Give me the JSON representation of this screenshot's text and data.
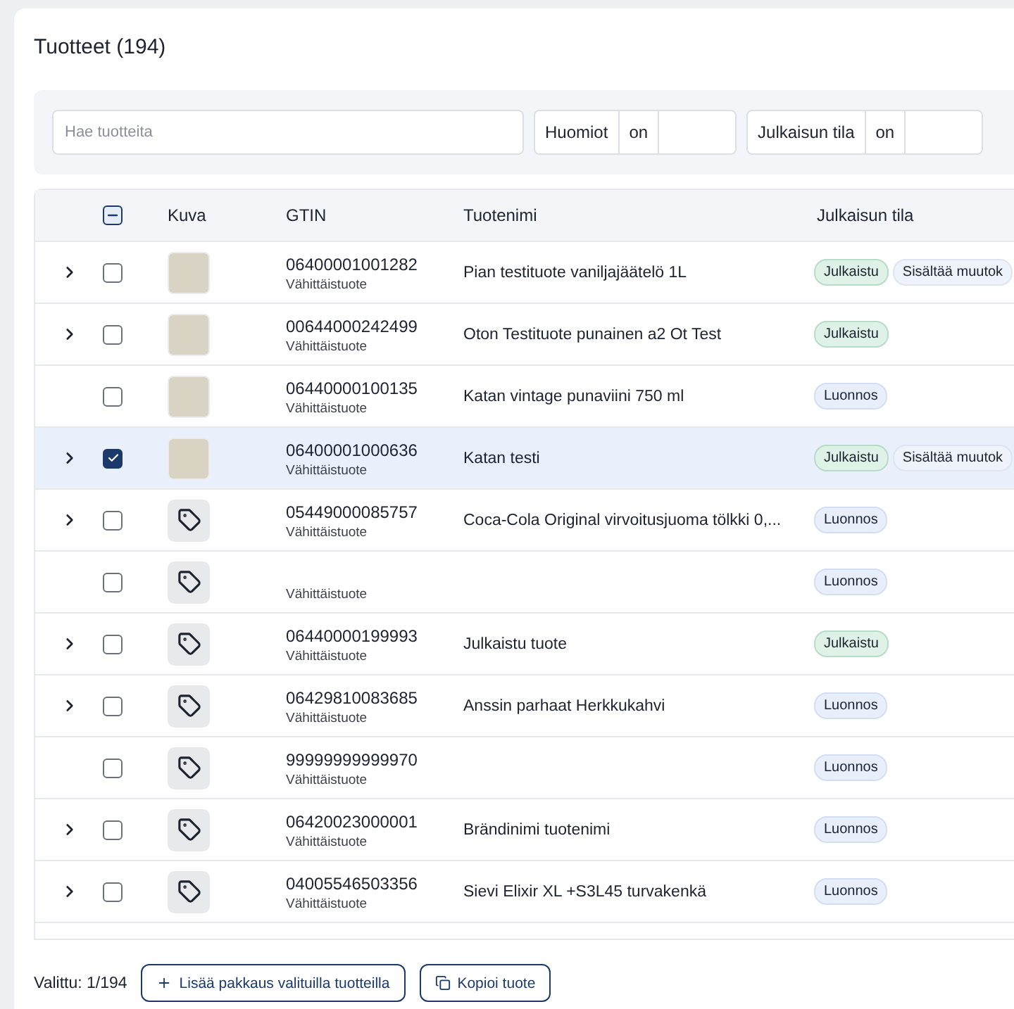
{
  "title": "Tuotteet (194)",
  "search": {
    "placeholder": "Hae tuotteita"
  },
  "filters": [
    {
      "label": "Huomiot",
      "operator": "on"
    },
    {
      "label": "Julkaisun tila",
      "operator": "on"
    }
  ],
  "table": {
    "header_checkbox": {
      "indeterminate": true
    },
    "columns": [
      "Kuva",
      "GTIN",
      "Tuotenimi",
      "Julkaisun tila"
    ],
    "rows": [
      {
        "expandable": true,
        "selected": false,
        "kind": "photo",
        "gtin": "06400001001282",
        "type": "Vähittäistuote",
        "name": "Pian testituote vaniljajäätelö 1L",
        "badges": [
          {
            "kind": "published",
            "label": "Julkaistu"
          },
          {
            "kind": "changes",
            "label": "Sisältää muutok"
          }
        ]
      },
      {
        "expandable": true,
        "selected": false,
        "kind": "photo",
        "gtin": "00644000242499",
        "type": "Vähittäistuote",
        "name": "Oton Testituote punainen a2 Ot Test",
        "badges": [
          {
            "kind": "published",
            "label": "Julkaistu"
          }
        ]
      },
      {
        "expandable": false,
        "selected": false,
        "kind": "photo",
        "gtin": "06440000100135",
        "type": "Vähittäistuote",
        "name": "Katan vintage punaviini 750 ml",
        "badges": [
          {
            "kind": "draft",
            "label": "Luonnos"
          }
        ]
      },
      {
        "expandable": true,
        "selected": true,
        "kind": "photo",
        "gtin": "06400001000636",
        "type": "Vähittäistuote",
        "name": "Katan testi",
        "badges": [
          {
            "kind": "published",
            "label": "Julkaistu"
          },
          {
            "kind": "changes",
            "label": "Sisältää muutok"
          }
        ]
      },
      {
        "expandable": true,
        "selected": false,
        "kind": "tag",
        "gtin": "05449000085757",
        "type": "Vähittäistuote",
        "name": "Coca-Cola Original virvoitusjuoma tölkki 0,...",
        "badges": [
          {
            "kind": "draft",
            "label": "Luonnos"
          }
        ]
      },
      {
        "expandable": false,
        "selected": false,
        "kind": "tag",
        "type": "Vähittäistuote",
        "badges": [
          {
            "kind": "draft",
            "label": "Luonnos"
          }
        ]
      },
      {
        "expandable": true,
        "selected": false,
        "kind": "tag",
        "gtin": "06440000199993",
        "type": "Vähittäistuote",
        "name": "Julkaistu tuote",
        "badges": [
          {
            "kind": "published",
            "label": "Julkaistu"
          }
        ]
      },
      {
        "expandable": true,
        "selected": false,
        "kind": "tag",
        "gtin": "06429810083685",
        "type": "Vähittäistuote",
        "name": "Anssin parhaat Herkkukahvi",
        "badges": [
          {
            "kind": "draft",
            "label": "Luonnos"
          }
        ]
      },
      {
        "expandable": false,
        "selected": false,
        "kind": "tag",
        "gtin": "99999999999970",
        "type": "Vähittäistuote",
        "badges": [
          {
            "kind": "draft",
            "label": "Luonnos"
          }
        ]
      },
      {
        "expandable": true,
        "selected": false,
        "kind": "tag",
        "gtin": "06420023000001",
        "type": "Vähittäistuote",
        "name": "Brändinimi tuotenimi",
        "badges": [
          {
            "kind": "draft",
            "label": "Luonnos"
          }
        ]
      },
      {
        "expandable": true,
        "selected": false,
        "kind": "tag",
        "gtin": "04005546503356",
        "type": "Vähittäistuote",
        "name": "Sievi Elixir XL +S3L45 turvakenkä",
        "badges": [
          {
            "kind": "draft",
            "label": "Luonnos"
          }
        ]
      }
    ]
  },
  "footer": {
    "selected_count": "Valittu: 1/194",
    "buttons": [
      {
        "kind": "add",
        "label": "Lisää pakkaus valituilla tuotteilla"
      },
      {
        "kind": "copy",
        "label": "Kopioi tuote"
      }
    ]
  }
}
